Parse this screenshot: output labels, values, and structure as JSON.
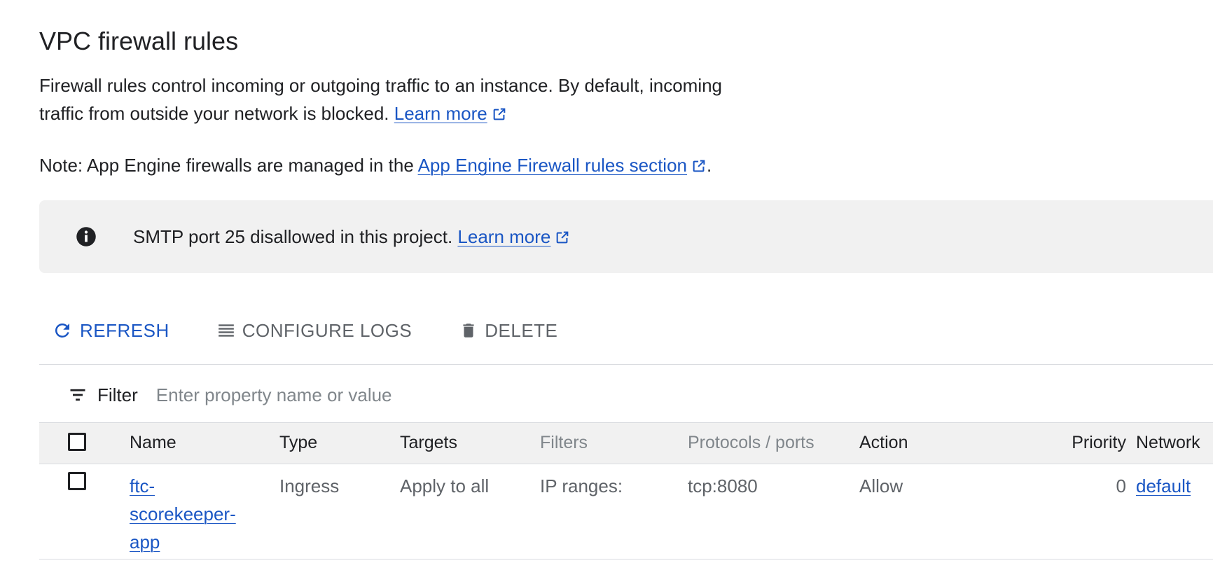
{
  "page": {
    "title": "VPC firewall rules",
    "description": "Firewall rules control incoming or outgoing traffic to an instance. By default, incoming traffic from outside your network is blocked.",
    "learn_more": "Learn more",
    "note_prefix": "Note: App Engine firewalls are managed in the",
    "note_link": "App Engine Firewall rules section",
    "note_suffix": "."
  },
  "banner": {
    "icon": "info-icon",
    "text": "SMTP port 25 disallowed in this project.",
    "link": "Learn more"
  },
  "toolbar": {
    "refresh": "REFRESH",
    "configure_logs": "CONFIGURE LOGS",
    "delete": "DELETE"
  },
  "filter": {
    "label": "Filter",
    "placeholder": "Enter property name or value"
  },
  "table": {
    "headers": {
      "name": "Name",
      "type": "Type",
      "targets": "Targets",
      "filters": "Filters",
      "protocols": "Protocols / ports",
      "action": "Action",
      "priority": "Priority",
      "network": "Network"
    },
    "rows": [
      {
        "name_line1": "ftc-",
        "name_line2": "scorekeeper-",
        "name_line3": "app",
        "type": "Ingress",
        "targets": "Apply to all",
        "filters": "IP ranges:",
        "protocols": "tcp:8080",
        "action": "Allow",
        "priority": "0",
        "network": "default"
      }
    ]
  },
  "colors": {
    "link": "#1a56c4",
    "muted": "#5f6368",
    "banner_bg": "#f1f1f1"
  }
}
